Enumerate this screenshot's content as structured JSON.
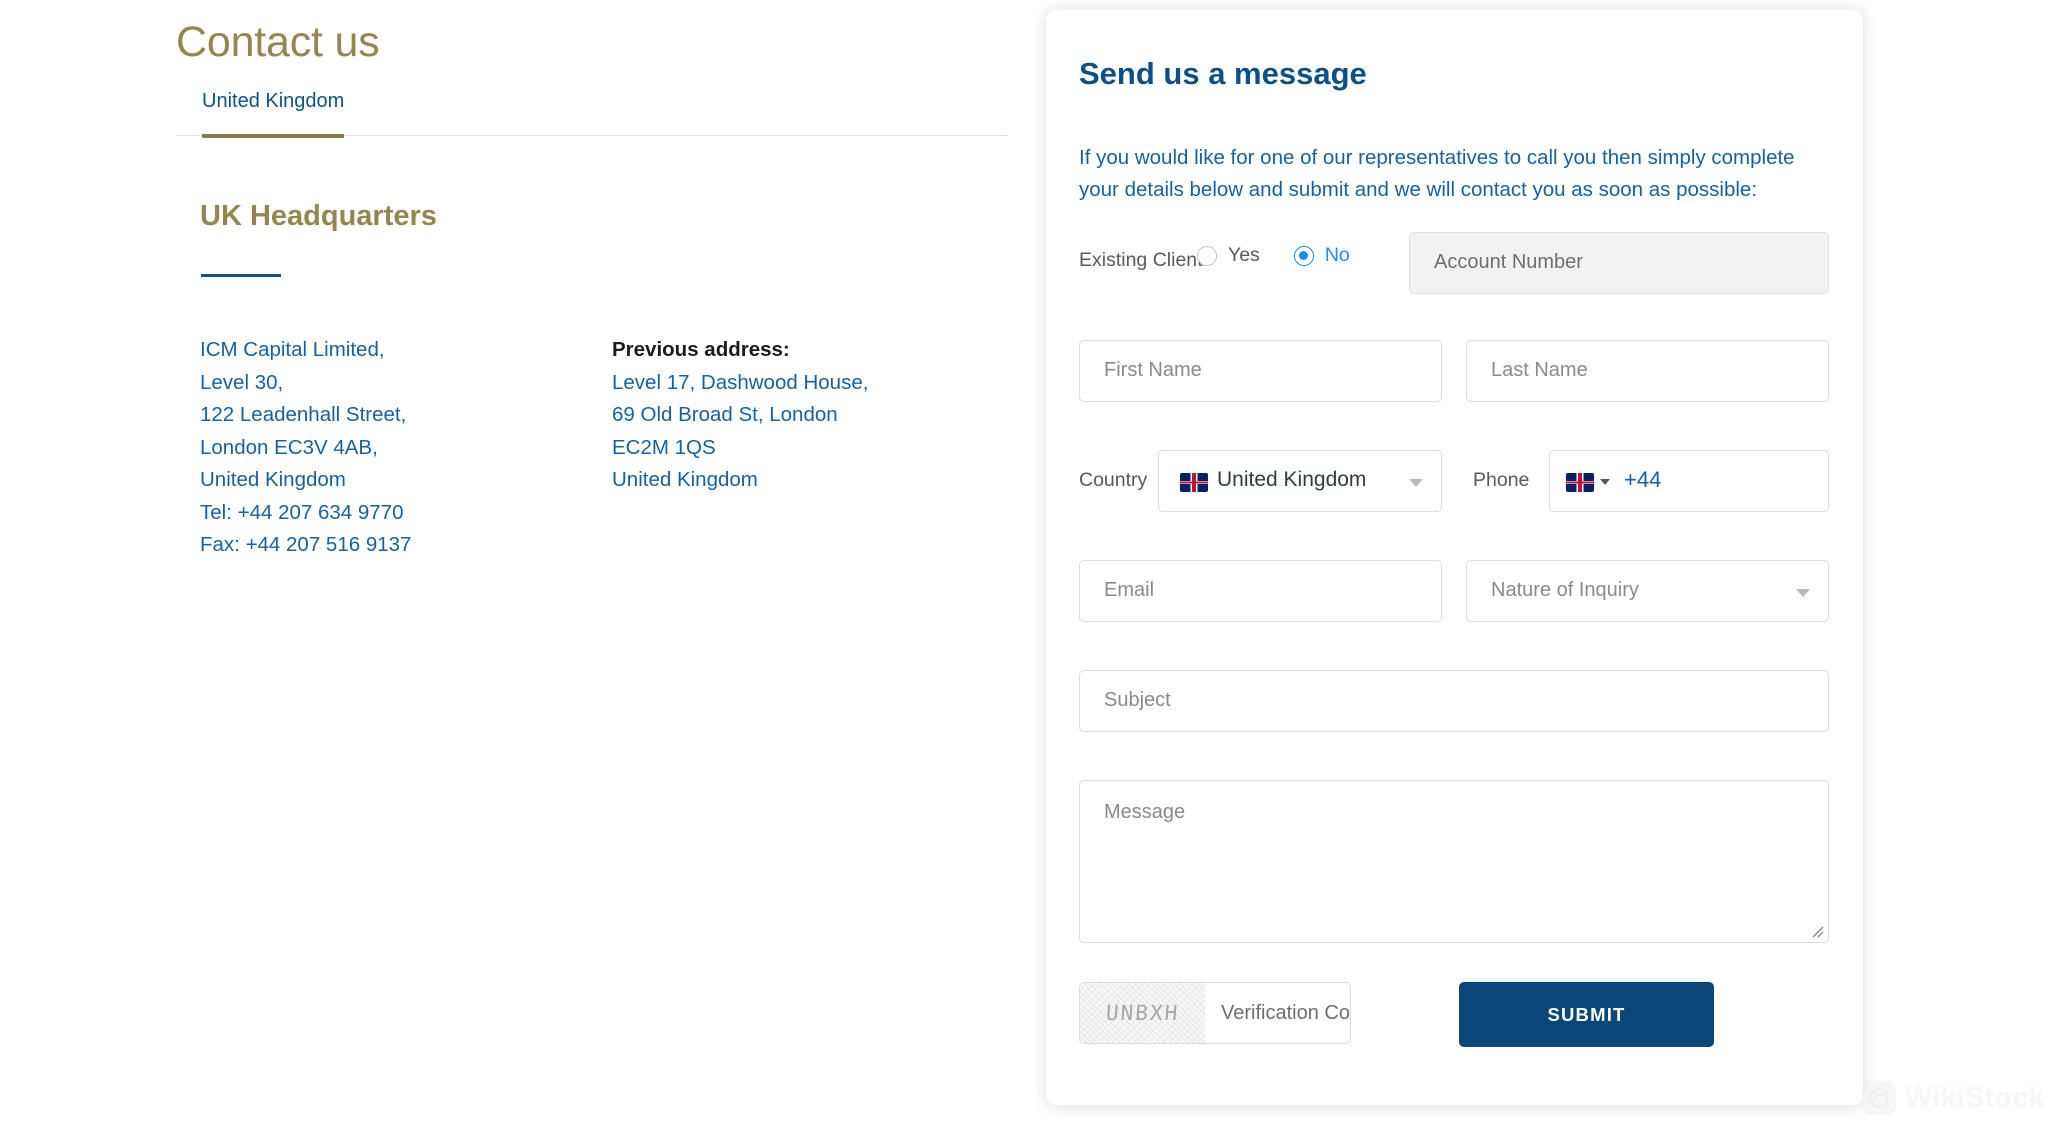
{
  "left": {
    "page_title": "Contact us",
    "tabs": [
      {
        "label": "United Kingdom",
        "active": true
      }
    ],
    "office": {
      "heading": "UK Headquarters",
      "address_lines": [
        "ICM Capital Limited,",
        "Level 30,",
        "122 Leadenhall Street,",
        "London EC3V 4AB,",
        "United Kingdom",
        "Tel: +44 207 634 9770",
        "Fax: +44 207 516 9137"
      ],
      "previous_label": "Previous address:",
      "previous_lines": [
        "Level 17, Dashwood House,",
        "69 Old Broad St, London",
        "EC2M 1QS",
        "United Kingdom"
      ]
    }
  },
  "form": {
    "title": "Send us a message",
    "intro": "If you would like for one of our representatives to call you then simply complete your details below and submit and we will contact you as soon as possible:",
    "existing_client": {
      "label": "Existing Client?",
      "options": [
        {
          "label": "Yes",
          "selected": false
        },
        {
          "label": "No",
          "selected": true
        }
      ]
    },
    "fields": {
      "account_number_placeholder": "Account Number",
      "first_name_placeholder": "First Name",
      "last_name_placeholder": "Last Name",
      "country_label": "Country",
      "country_value": "United Kingdom",
      "phone_label": "Phone",
      "phone_dial_code": "+44",
      "email_placeholder": "Email",
      "nature_placeholder": "Nature of Inquiry",
      "subject_placeholder": "Subject",
      "message_placeholder": "Message"
    },
    "captcha": {
      "code": "UNBXH",
      "input_placeholder": "Verification Co"
    },
    "submit_label": "SUBMIT"
  },
  "watermark": {
    "label": "WikiStock"
  },
  "colors": {
    "gold": "#96854f",
    "tab_underline": "#8b7b44",
    "link_blue": "#1362a3",
    "heading_blue": "#0d4f88",
    "radio_blue": "#1a8df0",
    "submit_bg": "#0a4679"
  }
}
